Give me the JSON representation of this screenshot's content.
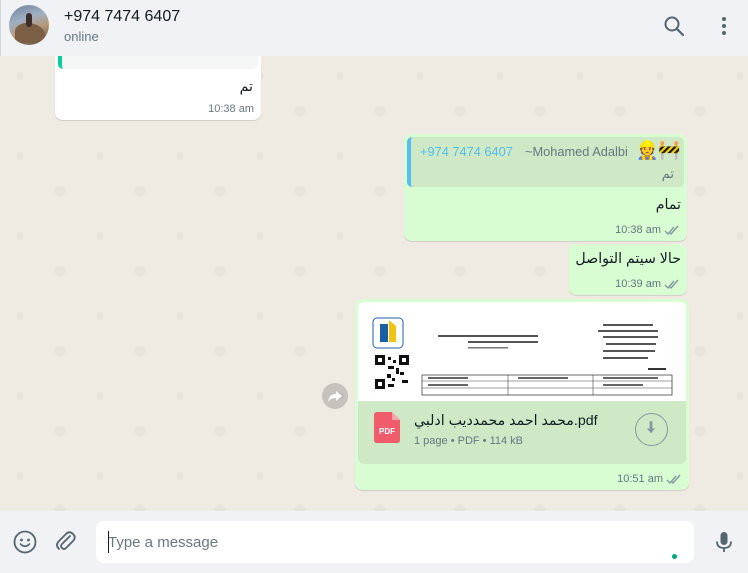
{
  "header": {
    "contact_name": "+974 7474 6407",
    "status": "online",
    "search_icon": "search-icon",
    "menu_icon": "menu-dots-icon"
  },
  "messages": [
    {
      "direction": "incoming",
      "text": "تم",
      "time": "10:38 am"
    },
    {
      "direction": "outgoing",
      "quote": {
        "sender": "+974 7474 6407",
        "author": "~Mohamed Adalbi",
        "emoji": "👷🚧",
        "text": "تم"
      },
      "text": "تمام",
      "time": "10:38 am",
      "status": "read"
    },
    {
      "direction": "outgoing",
      "text": "حالا سيتم التواصل",
      "time": "10:39 am",
      "status": "read"
    },
    {
      "direction": "outgoing",
      "document": {
        "name": "محمد احمد محمدديب ادلبي.pdf",
        "meta": "1 page • PDF • 114 kB",
        "icon": "pdf-icon"
      },
      "time": "10:51 am",
      "status": "read"
    }
  ],
  "composer": {
    "placeholder": "Type a message"
  },
  "colors": {
    "incoming": "#ffffff",
    "outgoing": "#d9fdd3",
    "accent": "#53bdeb",
    "brand": "#00a884",
    "background": "#efeae2"
  }
}
